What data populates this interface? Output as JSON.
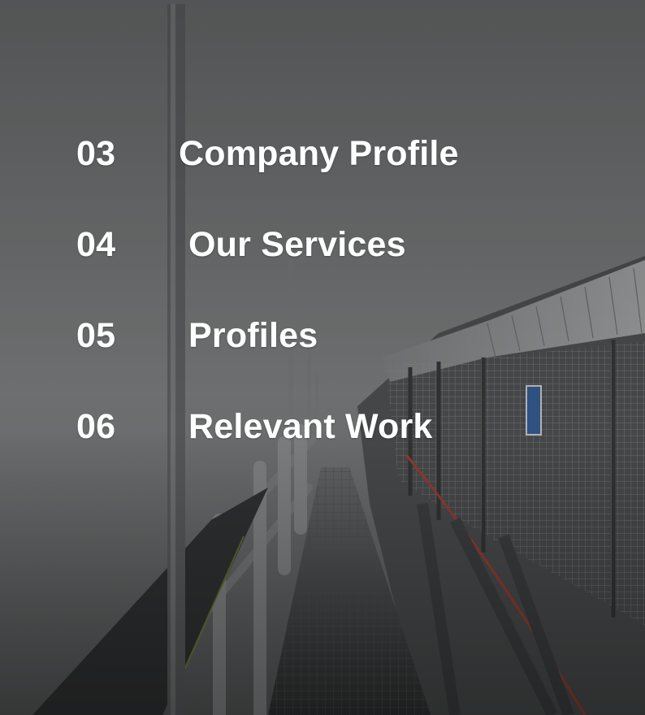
{
  "background": {
    "description_icon": "foggy-industrial-walkway-photo",
    "colors": {
      "sky": "#8a8c8c",
      "fog_dark": "#5e6061",
      "metal": "#6c6f70",
      "metal_dark": "#3b3d3e",
      "sign_blue": "#3d6aa6"
    }
  },
  "toc": {
    "items": [
      {
        "number": "03",
        "title": "Company Profile"
      },
      {
        "number": "04",
        "title": "Our Services"
      },
      {
        "number": "05",
        "title": "Profiles"
      },
      {
        "number": "06",
        "title": "Relevant Work"
      }
    ]
  }
}
